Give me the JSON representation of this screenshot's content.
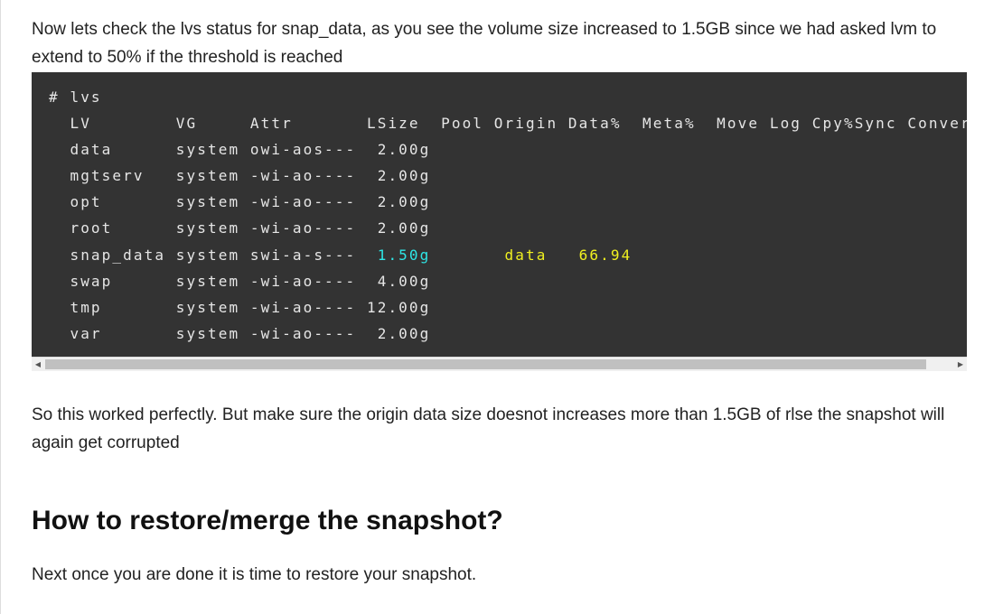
{
  "intro": "Now lets check the lvs status for snap_data, as you see the volume size increased to 1.5GB since we had asked lvm to extend to 50% if the threshold is reached",
  "code": {
    "colors": {
      "text": "#e6e6e6",
      "cyan": "#2ee6e6",
      "yellow": "#f0f020",
      "background": "#333333"
    },
    "lines": [
      [
        {
          "t": "# lvs"
        }
      ],
      [
        {
          "t": "  LV        VG     Attr       LSize  Pool Origin Data%  Meta%  Move Log Cpy%Sync Convert"
        }
      ],
      [
        {
          "t": "  data      system owi-aos---  2.00g"
        }
      ],
      [
        {
          "t": "  mgtserv   system -wi-ao----  2.00g"
        }
      ],
      [
        {
          "t": "  opt       system -wi-ao----  2.00g"
        }
      ],
      [
        {
          "t": "  root      system -wi-ao----  2.00g"
        }
      ],
      [
        {
          "t": "  snap_data system swi-a-s---  "
        },
        {
          "t": "1.50g",
          "c": "cyan"
        },
        {
          "t": "       "
        },
        {
          "t": "data",
          "c": "yellow"
        },
        {
          "t": "   "
        },
        {
          "t": "66.94",
          "c": "yellow"
        }
      ],
      [
        {
          "t": "  swap      system -wi-ao----  4.00g"
        }
      ],
      [
        {
          "t": "  tmp       system -wi-ao---- 12.00g"
        }
      ],
      [
        {
          "t": "  var       system -wi-ao----  2.00g"
        }
      ]
    ]
  },
  "after": "So this worked perfectly. But make sure the origin data size doesnot increases more than 1.5GB of rlse the snapshot will again get corrupted",
  "heading": "How to restore/merge the snapshot?",
  "next": "Next once you are done it is time to restore your snapshot."
}
